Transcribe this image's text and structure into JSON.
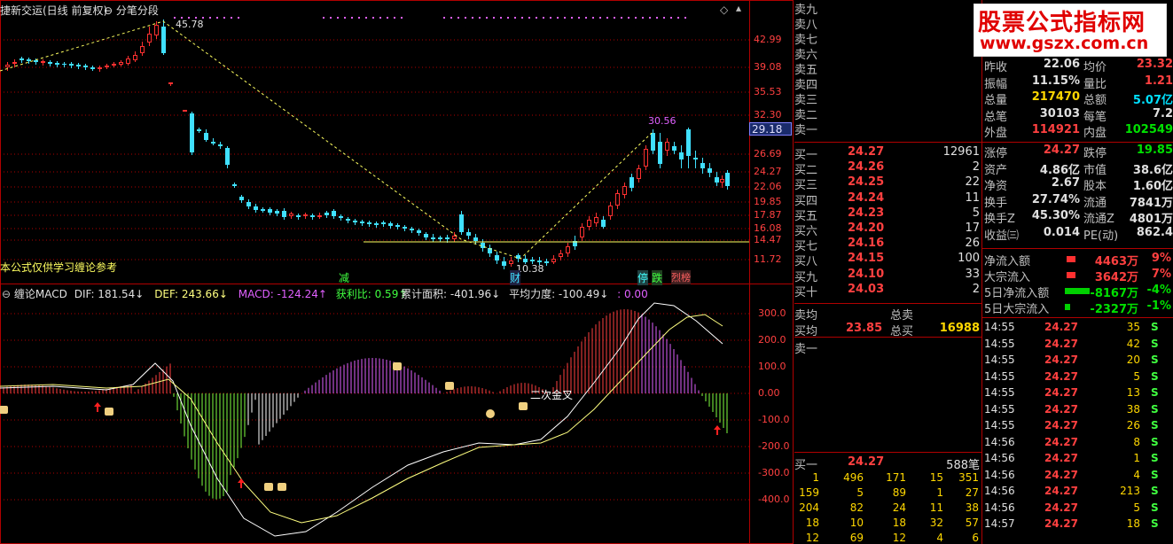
{
  "header": {
    "title": "捷新交运(日线 前复权)",
    "dropdown": "分笔分段",
    "indicator_name": "缠论MACD",
    "dif": "DIF: 181.54↓",
    "def": "DEF: 243.66↓",
    "macd": "MACD: -124.24↑",
    "profit": "获利比: 0.59↑",
    "area": "累计面积: -401.96↓",
    "avg_force": "平均力度: -100.49↓",
    "extra": ": 0.00",
    "note": "本公式仅供学习缠论参考"
  },
  "price_axis": [
    "42.99",
    "39.08",
    "35.53",
    "32.30",
    "29.18",
    "26.69",
    "24.27",
    "22.06",
    "19.85",
    "17.87",
    "16.08",
    "14.47",
    "11.72"
  ],
  "macd_axis": [
    "300.0",
    "200.0",
    "100.0",
    "0.00",
    "-100.0",
    "-200.0",
    "-300.0",
    "-400.0"
  ],
  "price_annotations": {
    "high": "45.78",
    "peak2": "30.56",
    "low": "10.38"
  },
  "signals": {
    "jian": "减",
    "cai": "财",
    "ting": "停",
    "die": "跌",
    "lie": "烈榜"
  },
  "macd_labels": {
    "golden_cross": "二次金叉"
  },
  "watermark": {
    "line1": "股票公式指标网",
    "line2": "www.gszx.com.cn"
  },
  "order_book": {
    "sell": [
      {
        "label": "卖九"
      },
      {
        "label": "卖八"
      },
      {
        "label": "卖七"
      },
      {
        "label": "卖六"
      },
      {
        "label": "卖五"
      },
      {
        "label": "卖四"
      },
      {
        "label": "卖三"
      },
      {
        "label": "卖二"
      },
      {
        "label": "卖一"
      }
    ],
    "buy": [
      {
        "label": "买一",
        "price": "24.27",
        "vol": "12961"
      },
      {
        "label": "买二",
        "price": "24.26",
        "vol": "2"
      },
      {
        "label": "买三",
        "price": "24.25",
        "vol": "22"
      },
      {
        "label": "买四",
        "price": "24.24",
        "vol": "11"
      },
      {
        "label": "买五",
        "price": "24.23",
        "vol": "5"
      },
      {
        "label": "买六",
        "price": "24.20",
        "vol": "17"
      },
      {
        "label": "买七",
        "price": "24.16",
        "vol": "26"
      },
      {
        "label": "买八",
        "price": "24.15",
        "vol": "100"
      },
      {
        "label": "买九",
        "price": "24.10",
        "vol": "33"
      },
      {
        "label": "买十",
        "price": "24.03",
        "vol": "2"
      }
    ],
    "sell_avg_label": "卖均",
    "total_sell_label": "总卖",
    "buy_avg_label": "买均",
    "buy_avg": "23.85",
    "total_buy_label": "总买",
    "total_buy": "16988",
    "sell_one_label": "卖一",
    "buy_one_label": "买一",
    "buy_one_price": "24.27",
    "buy_one_count": "588笔",
    "queue": [
      [
        "1",
        "496",
        "171",
        "15",
        "351"
      ],
      [
        "159",
        "5",
        "89",
        "1",
        "27"
      ],
      [
        "204",
        "82",
        "24",
        "11",
        "38"
      ],
      [
        "18",
        "10",
        "18",
        "32",
        "57"
      ],
      [
        "12",
        "69",
        "12",
        "4",
        "6"
      ]
    ]
  },
  "quote": {
    "rows": [
      {
        "l1": "昨收",
        "v1": "22.06",
        "c1": "#e0e0e0",
        "l2": "均价",
        "v2": "23.32",
        "c2": "#ff4040"
      },
      {
        "l1": "振幅",
        "v1": "11.15%",
        "c1": "#e0e0e0",
        "l2": "量比",
        "v2": "1.21",
        "c2": "#ff4040"
      },
      {
        "l1": "总量",
        "v1": "217470",
        "c1": "#ffd700",
        "l2": "总额",
        "v2": "5.07亿",
        "c2": "#00e0ff"
      },
      {
        "l1": "总笔",
        "v1": "30103",
        "c1": "#e0e0e0",
        "l2": "每笔",
        "v2": "7.2",
        "c2": "#e0e0e0"
      },
      {
        "l1": "外盘",
        "v1": "114921",
        "c1": "#ff4040",
        "l2": "内盘",
        "v2": "102549",
        "c2": "#00e000"
      },
      {
        "l1": "涨停",
        "v1": "24.27",
        "c1": "#ff4040",
        "l2": "跌停",
        "v2": "19.85",
        "c2": "#00e000"
      },
      {
        "l1": "资产",
        "v1": "4.86亿",
        "c1": "#e0e0e0",
        "l2": "市值",
        "v2": "38.6亿",
        "c2": "#e0e0e0"
      },
      {
        "l1": "净资",
        "v1": "2.67",
        "c1": "#e0e0e0",
        "l2": "股本",
        "v2": "1.60亿",
        "c2": "#e0e0e0"
      },
      {
        "l1": "换手",
        "v1": "27.74%",
        "c1": "#e0e0e0",
        "l2": "流通",
        "v2": "7841万",
        "c2": "#e0e0e0"
      },
      {
        "l1": "换手Z",
        "v1": "45.30%",
        "c1": "#e0e0e0",
        "l2": "流通Z",
        "v2": "4801万",
        "c2": "#e0e0e0"
      },
      {
        "l1": "收益㈢",
        "v1": "0.014",
        "c1": "#e0e0e0",
        "l2": "PE(动)",
        "v2": "862.4",
        "c2": "#e0e0e0"
      }
    ],
    "flows": [
      {
        "label": "净流入额",
        "value": "4463万",
        "pct": "9%",
        "bar": "#ff3030",
        "pct_color": "#ff4040"
      },
      {
        "label": "大宗流入",
        "value": "3642万",
        "pct": "7%",
        "bar": "#ff3030",
        "pct_color": "#ff4040"
      },
      {
        "label": "5日净流入额",
        "value": "-8167万",
        "pct": "-4%",
        "bar": "#00d000",
        "pct_color": "#00e000"
      },
      {
        "label": "5日大宗流入",
        "value": "-2327万",
        "pct": "-1%",
        "bar": "#00d000",
        "pct_color": "#00e000"
      }
    ]
  },
  "ticks": [
    {
      "time": "14:55",
      "price": "24.27",
      "vol": "35",
      "dir": "S"
    },
    {
      "time": "14:55",
      "price": "24.27",
      "vol": "42",
      "dir": "S"
    },
    {
      "time": "14:55",
      "price": "24.27",
      "vol": "20",
      "dir": "S"
    },
    {
      "time": "14:55",
      "price": "24.27",
      "vol": "5",
      "dir": "S"
    },
    {
      "time": "14:55",
      "price": "24.27",
      "vol": "13",
      "dir": "S"
    },
    {
      "time": "14:55",
      "price": "24.27",
      "vol": "38",
      "dir": "S"
    },
    {
      "time": "14:55",
      "price": "24.27",
      "vol": "26",
      "dir": "S"
    },
    {
      "time": "14:56",
      "price": "24.27",
      "vol": "8",
      "dir": "S"
    },
    {
      "time": "14:56",
      "price": "24.27",
      "vol": "1",
      "dir": "S"
    },
    {
      "time": "14:56",
      "price": "24.27",
      "vol": "4",
      "dir": "S"
    },
    {
      "time": "14:56",
      "price": "24.27",
      "vol": "213",
      "dir": "S"
    },
    {
      "time": "14:56",
      "price": "24.27",
      "vol": "5",
      "dir": "S"
    },
    {
      "time": "14:57",
      "price": "24.27",
      "vol": "18",
      "dir": "S"
    }
  ]
}
